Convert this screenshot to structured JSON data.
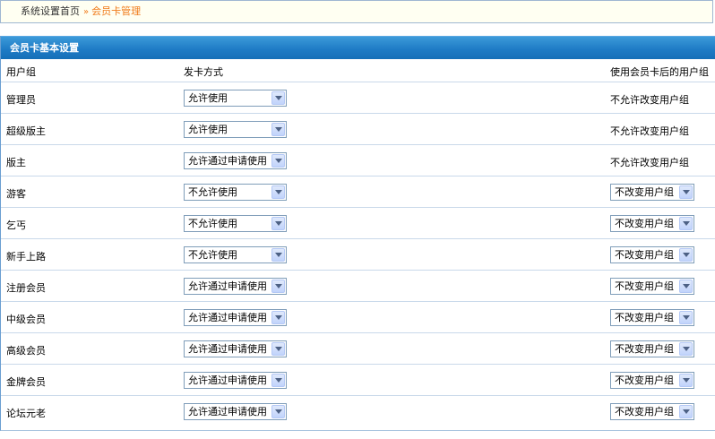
{
  "breadcrumb": {
    "home": "系统设置首页",
    "separator": "»",
    "current": "会员卡管理"
  },
  "panel": {
    "title": "会员卡基本设置"
  },
  "columns": {
    "group": "用户组",
    "method": "发卡方式",
    "after": "使用会员卡后的用户组"
  },
  "rows": [
    {
      "name": "管理员",
      "method": "允许使用",
      "after": "不允许改变用户组",
      "after_is_select": false
    },
    {
      "name": "超级版主",
      "method": "允许使用",
      "after": "不允许改变用户组",
      "after_is_select": false
    },
    {
      "name": "版主",
      "method": "允许通过申请使用",
      "after": "不允许改变用户组",
      "after_is_select": false
    },
    {
      "name": "游客",
      "method": "不允许使用",
      "after": "不改变用户组",
      "after_is_select": true
    },
    {
      "name": "乞丐",
      "method": "不允许使用",
      "after": "不改变用户组",
      "after_is_select": true
    },
    {
      "name": "新手上路",
      "method": "不允许使用",
      "after": "不改变用户组",
      "after_is_select": true
    },
    {
      "name": "注册会员",
      "method": "允许通过申请使用",
      "after": "不改变用户组",
      "after_is_select": true
    },
    {
      "name": "中级会员",
      "method": "允许通过申请使用",
      "after": "不改变用户组",
      "after_is_select": true
    },
    {
      "name": "高级会员",
      "method": "允许通过申请使用",
      "after": "不改变用户组",
      "after_is_select": true
    },
    {
      "name": "金牌会员",
      "method": "允许通过申请使用",
      "after": "不改变用户组",
      "after_is_select": true
    },
    {
      "name": "论坛元老",
      "method": "允许通过申请使用",
      "after": "不改变用户组",
      "after_is_select": true
    }
  ],
  "colors": {
    "header_blue": "#1f7cc6",
    "breadcrumb_accent": "#f07b1b",
    "select_border": "#7f9db9"
  }
}
